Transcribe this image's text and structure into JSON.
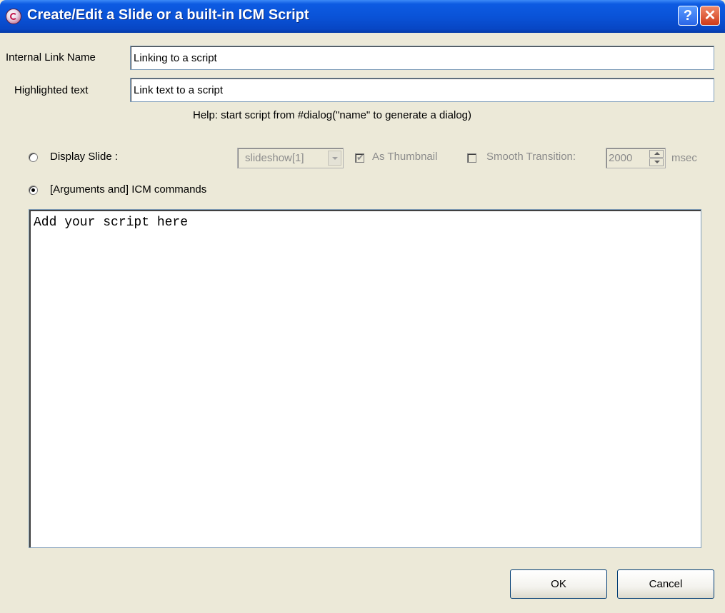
{
  "window": {
    "title": "Create/Edit a Slide or a built-in ICM Script",
    "help_button": "?",
    "close_button": "✕"
  },
  "fields": {
    "internal_link_name_label": "Internal Link Name",
    "internal_link_name_value": "Linking to a script",
    "highlighted_text_label": "Highlighted text",
    "highlighted_text_value": "Link text to a script"
  },
  "help_text": "Help: start script from #dialog(\"name\" to generate a dialog)",
  "options": {
    "display_slide_label": "Display Slide :",
    "display_slide_selected": false,
    "slideshow_value": "slideshow[1]",
    "as_thumbnail_label": "As Thumbnail",
    "as_thumbnail_checked": true,
    "smooth_transition_label": "Smooth Transition:",
    "smooth_transition_checked": false,
    "transition_ms": "2000",
    "msec_label": "msec",
    "icm_commands_label": "[Arguments and] ICM commands",
    "icm_commands_selected": true
  },
  "script": {
    "content": "Add your script here"
  },
  "buttons": {
    "ok": "OK",
    "cancel": "Cancel"
  }
}
